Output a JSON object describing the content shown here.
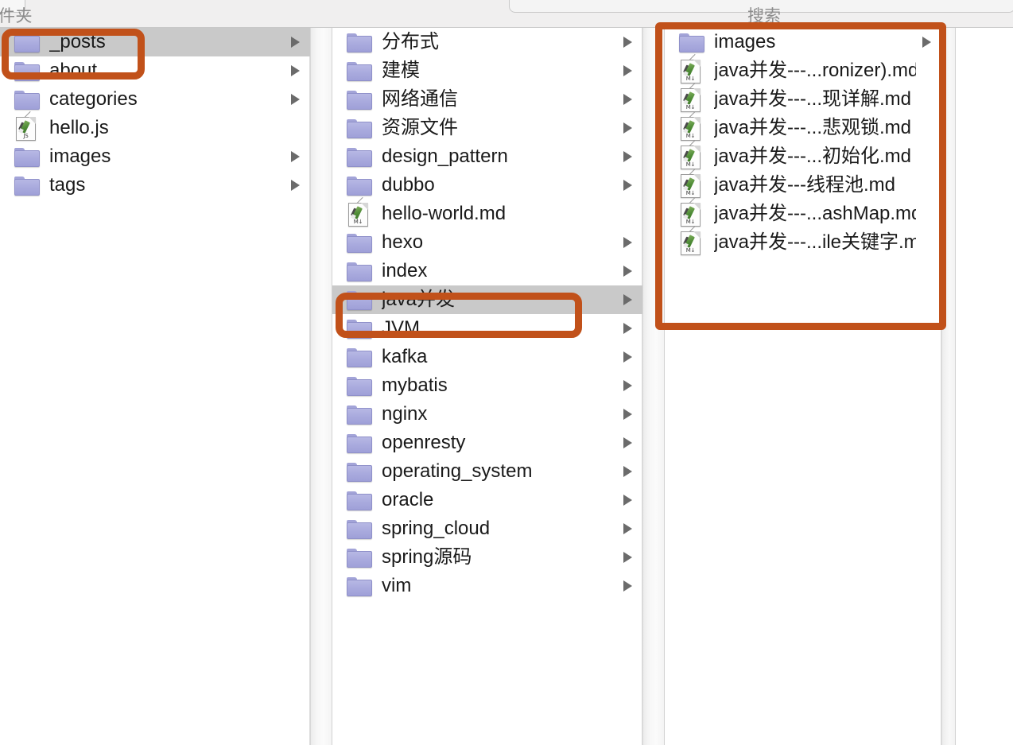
{
  "window": {
    "top_left_label": "件夹",
    "search_label": "搜索"
  },
  "columns": [
    {
      "id": "column-1",
      "items": [
        {
          "name": "_posts",
          "kind": "folder",
          "selected": true,
          "has_children": true,
          "icon": "folder-icon"
        },
        {
          "name": "about",
          "kind": "folder",
          "selected": false,
          "has_children": true,
          "icon": "folder-icon"
        },
        {
          "name": "categories",
          "kind": "folder",
          "selected": false,
          "has_children": true,
          "icon": "folder-icon"
        },
        {
          "name": "hello.js",
          "kind": "js",
          "selected": false,
          "has_children": false,
          "icon": "js-file-icon",
          "badge": "JS"
        },
        {
          "name": "images",
          "kind": "folder",
          "selected": false,
          "has_children": true,
          "icon": "folder-icon"
        },
        {
          "name": "tags",
          "kind": "folder",
          "selected": false,
          "has_children": true,
          "icon": "folder-icon"
        }
      ]
    },
    {
      "id": "column-2",
      "items": [
        {
          "name": "分布式",
          "kind": "folder",
          "selected": false,
          "has_children": true,
          "icon": "folder-icon"
        },
        {
          "name": "建模",
          "kind": "folder",
          "selected": false,
          "has_children": true,
          "icon": "folder-icon"
        },
        {
          "name": "网络通信",
          "kind": "folder",
          "selected": false,
          "has_children": true,
          "icon": "folder-icon"
        },
        {
          "name": "资源文件",
          "kind": "folder",
          "selected": false,
          "has_children": true,
          "icon": "folder-icon"
        },
        {
          "name": "design_pattern",
          "kind": "folder",
          "selected": false,
          "has_children": true,
          "icon": "folder-icon"
        },
        {
          "name": "dubbo",
          "kind": "folder",
          "selected": false,
          "has_children": true,
          "icon": "folder-icon"
        },
        {
          "name": "hello-world.md",
          "kind": "markdown",
          "selected": false,
          "has_children": false,
          "icon": "markdown-file-icon",
          "badge": "M↓"
        },
        {
          "name": "hexo",
          "kind": "folder",
          "selected": false,
          "has_children": true,
          "icon": "folder-icon"
        },
        {
          "name": "index",
          "kind": "folder",
          "selected": false,
          "has_children": true,
          "icon": "folder-icon"
        },
        {
          "name": "java并发",
          "kind": "folder",
          "selected": true,
          "has_children": true,
          "icon": "folder-icon"
        },
        {
          "name": "JVM",
          "kind": "folder",
          "selected": false,
          "has_children": true,
          "icon": "folder-icon"
        },
        {
          "name": "kafka",
          "kind": "folder",
          "selected": false,
          "has_children": true,
          "icon": "folder-icon"
        },
        {
          "name": "mybatis",
          "kind": "folder",
          "selected": false,
          "has_children": true,
          "icon": "folder-icon"
        },
        {
          "name": "nginx",
          "kind": "folder",
          "selected": false,
          "has_children": true,
          "icon": "folder-icon"
        },
        {
          "name": "openresty",
          "kind": "folder",
          "selected": false,
          "has_children": true,
          "icon": "folder-icon"
        },
        {
          "name": "operating_system",
          "kind": "folder",
          "selected": false,
          "has_children": true,
          "icon": "folder-icon"
        },
        {
          "name": "oracle",
          "kind": "folder",
          "selected": false,
          "has_children": true,
          "icon": "folder-icon"
        },
        {
          "name": "spring_cloud",
          "kind": "folder",
          "selected": false,
          "has_children": true,
          "icon": "folder-icon"
        },
        {
          "name": "spring源码",
          "kind": "folder",
          "selected": false,
          "has_children": true,
          "icon": "folder-icon"
        },
        {
          "name": "vim",
          "kind": "folder",
          "selected": false,
          "has_children": true,
          "icon": "folder-icon"
        }
      ]
    },
    {
      "id": "column-3",
      "items": [
        {
          "name": "images",
          "kind": "folder",
          "selected": false,
          "has_children": true,
          "icon": "folder-icon"
        },
        {
          "name": "java并发---...ronizer).md",
          "kind": "markdown",
          "selected": false,
          "has_children": false,
          "icon": "markdown-file-icon",
          "badge": "M↓"
        },
        {
          "name": "java并发---...现详解.md",
          "kind": "markdown",
          "selected": false,
          "has_children": false,
          "icon": "markdown-file-icon",
          "badge": "M↓"
        },
        {
          "name": "java并发---...悲观锁.md",
          "kind": "markdown",
          "selected": false,
          "has_children": false,
          "icon": "markdown-file-icon",
          "badge": "M↓"
        },
        {
          "name": "java并发---...初始化.md",
          "kind": "markdown",
          "selected": false,
          "has_children": false,
          "icon": "markdown-file-icon",
          "badge": "M↓"
        },
        {
          "name": "java并发---线程池.md",
          "kind": "markdown",
          "selected": false,
          "has_children": false,
          "icon": "markdown-file-icon",
          "badge": "M↓"
        },
        {
          "name": "java并发---...ashMap.md",
          "kind": "markdown",
          "selected": false,
          "has_children": false,
          "icon": "markdown-file-icon",
          "badge": "M↓"
        },
        {
          "name": "java并发---...ile关键字.md",
          "kind": "markdown",
          "selected": false,
          "has_children": false,
          "icon": "markdown-file-icon",
          "badge": "M↓"
        }
      ]
    }
  ],
  "annotations": [
    {
      "id": "annot-posts",
      "target": "_posts",
      "color": "#c1511a"
    },
    {
      "id": "annot-java",
      "target": "java并发",
      "color": "#c1511a"
    },
    {
      "id": "annot-files",
      "target": "column-3",
      "color": "#c1511a"
    }
  ]
}
